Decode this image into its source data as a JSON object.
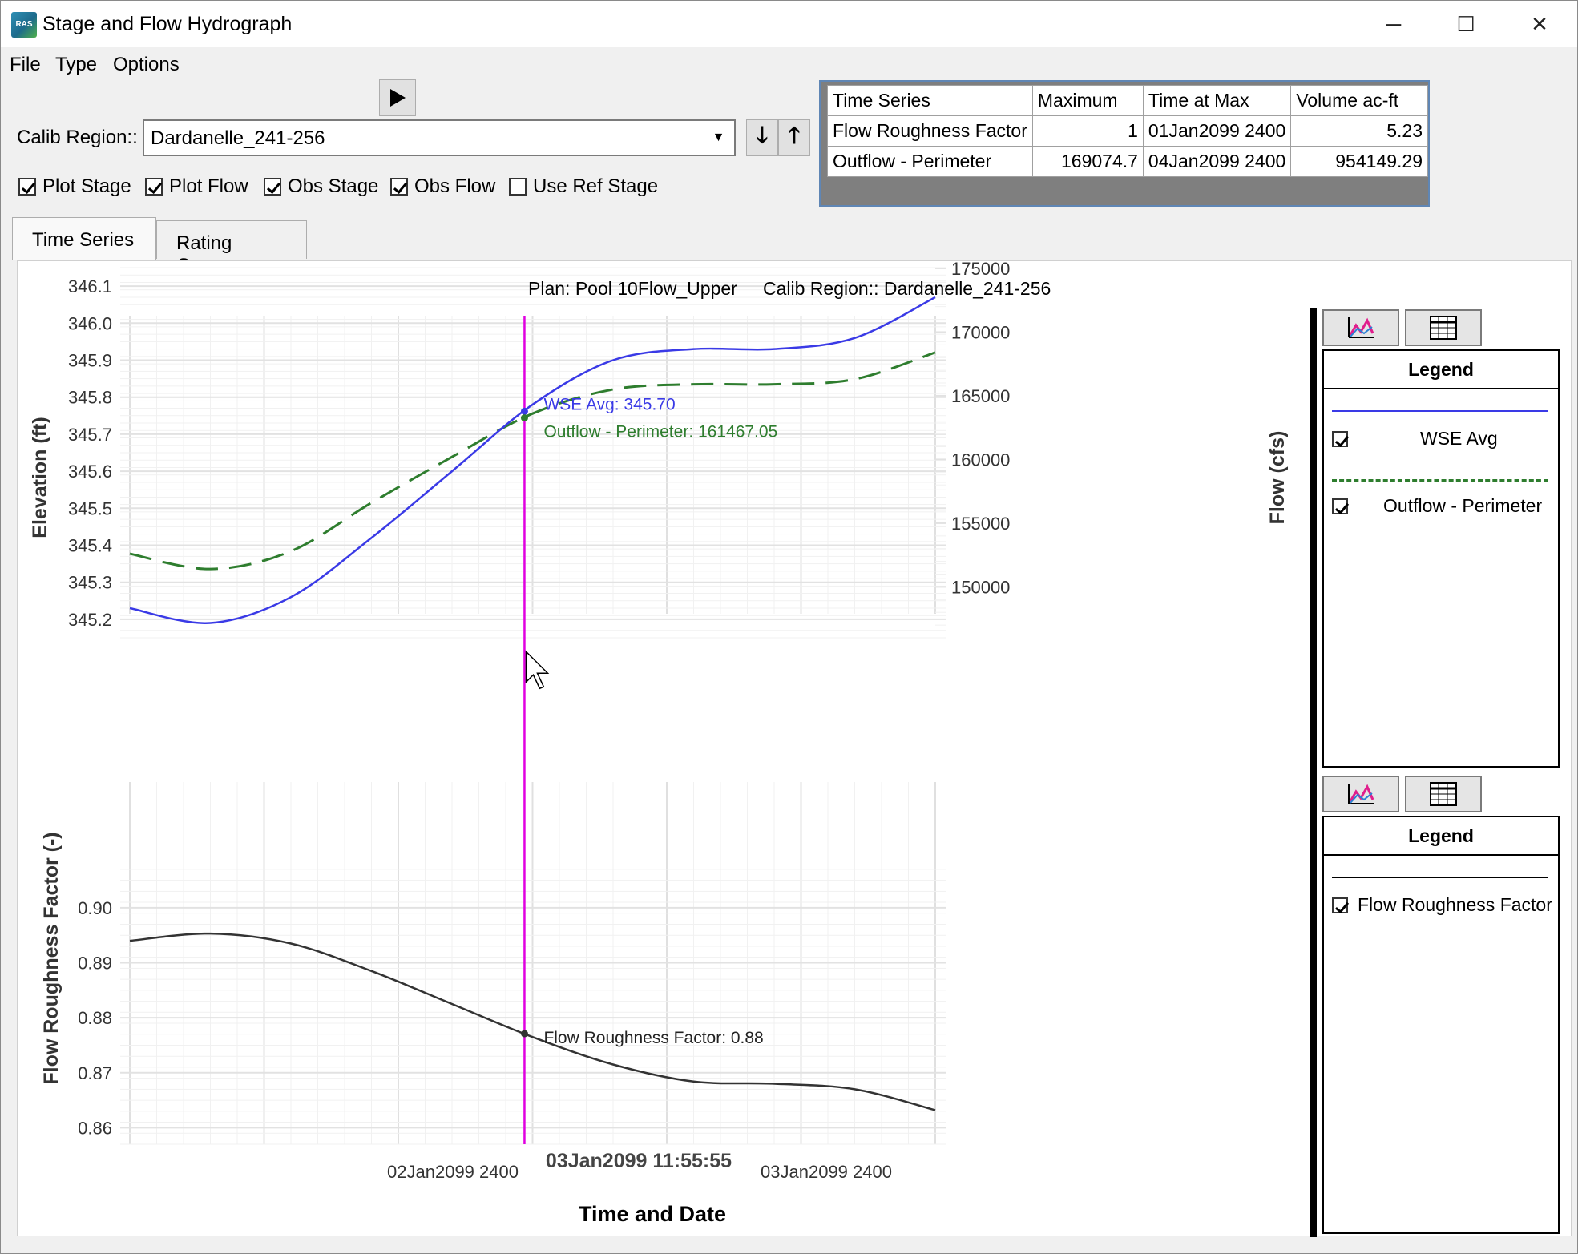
{
  "window": {
    "title": "Stage and Flow Hydrograph",
    "icon_label": "RAS",
    "controls": {
      "minimize": "─",
      "maximize": "☐",
      "close": "✕"
    }
  },
  "menu": [
    "File",
    "Type",
    "Options"
  ],
  "toolbar": {
    "calib_label": "Calib Region::",
    "calib_value": "Dardanelle_241-256",
    "checkboxes": [
      {
        "label": "Plot Stage",
        "checked": true
      },
      {
        "label": "Plot Flow",
        "checked": true
      },
      {
        "label": "Obs Stage",
        "checked": true
      },
      {
        "label": "Obs Flow",
        "checked": true
      },
      {
        "label": "Use Ref Stage",
        "checked": false
      }
    ]
  },
  "stats": {
    "headers": [
      "Time Series",
      "Maximum",
      "Time at Max",
      "Volume ac-ft"
    ],
    "rows": [
      [
        "Flow Roughness Factor",
        "1",
        "01Jan2099 2400",
        "5.23"
      ],
      [
        "Outflow - Perimeter",
        "169074.7",
        "04Jan2099 2400",
        "954149.29"
      ]
    ]
  },
  "tabs": [
    "Time Series",
    "Rating Curve"
  ],
  "plot": {
    "title_plan": "Plan: Pool 10Flow_Upper",
    "title_region": "Calib Region:: Dardanelle_241-256",
    "cursor_time": "03Jan2099 11:55:55",
    "xlabel": "Time and Date",
    "x_ticks": [
      "02Jan2099 2400",
      "03Jan2099 2400"
    ],
    "annotations": {
      "wse": "WSE Avg: 345.70",
      "outflow": "Outflow - Perimeter: 161467.05",
      "roughness": "Flow Roughness Factor: 0.88"
    }
  },
  "legends": {
    "upper": {
      "title": "Legend",
      "entries": [
        "WSE Avg",
        "Outflow - Perimeter"
      ]
    },
    "lower": {
      "title": "Legend",
      "entries": [
        "Flow Roughness Factor"
      ]
    }
  },
  "colors": {
    "wse": "#3a3ae6",
    "outflow": "#2e7d2e",
    "roughness": "#333333",
    "cursor": "#e000e0"
  },
  "chart_data": [
    {
      "type": "line",
      "ylabel": "Elevation (ft)",
      "y2label": "Flow (cfs)",
      "ylim": [
        345.15,
        346.15
      ],
      "y2lim": [
        146000,
        175500
      ],
      "y_ticks": [
        345.2,
        345.3,
        345.4,
        345.5,
        345.6,
        345.7,
        345.8,
        345.9,
        346.0,
        346.1
      ],
      "y2_ticks": [
        150000,
        155000,
        160000,
        165000,
        170000,
        175000
      ],
      "x": [
        0,
        0.1,
        0.2,
        0.3,
        0.4,
        0.5,
        0.6,
        0.7,
        0.8,
        0.9,
        1.0
      ],
      "series": [
        {
          "name": "WSE Avg",
          "axis": "left",
          "values": [
            345.23,
            345.19,
            345.26,
            345.42,
            345.6,
            345.78,
            345.9,
            345.93,
            345.93,
            345.96,
            346.07
          ]
        },
        {
          "name": "Outflow - Perimeter",
          "axis": "right",
          "values": [
            152600,
            151400,
            152800,
            156600,
            160200,
            163600,
            165500,
            165900,
            165900,
            166300,
            168400
          ]
        }
      ],
      "cursor_x": 0.49
    },
    {
      "type": "line",
      "ylabel": "Flow Roughness Factor (-)",
      "ylim": [
        0.857,
        0.908
      ],
      "y_ticks": [
        0.86,
        0.87,
        0.88,
        0.89,
        0.9
      ],
      "x": [
        0,
        0.1,
        0.2,
        0.3,
        0.4,
        0.5,
        0.6,
        0.7,
        0.8,
        0.9,
        1.0
      ],
      "series": [
        {
          "name": "Flow Roughness Factor",
          "axis": "left",
          "values": [
            0.894,
            0.8953,
            0.8935,
            0.8885,
            0.8825,
            0.8765,
            0.8715,
            0.8684,
            0.868,
            0.867,
            0.8632
          ]
        }
      ],
      "cursor_x": 0.49
    }
  ]
}
